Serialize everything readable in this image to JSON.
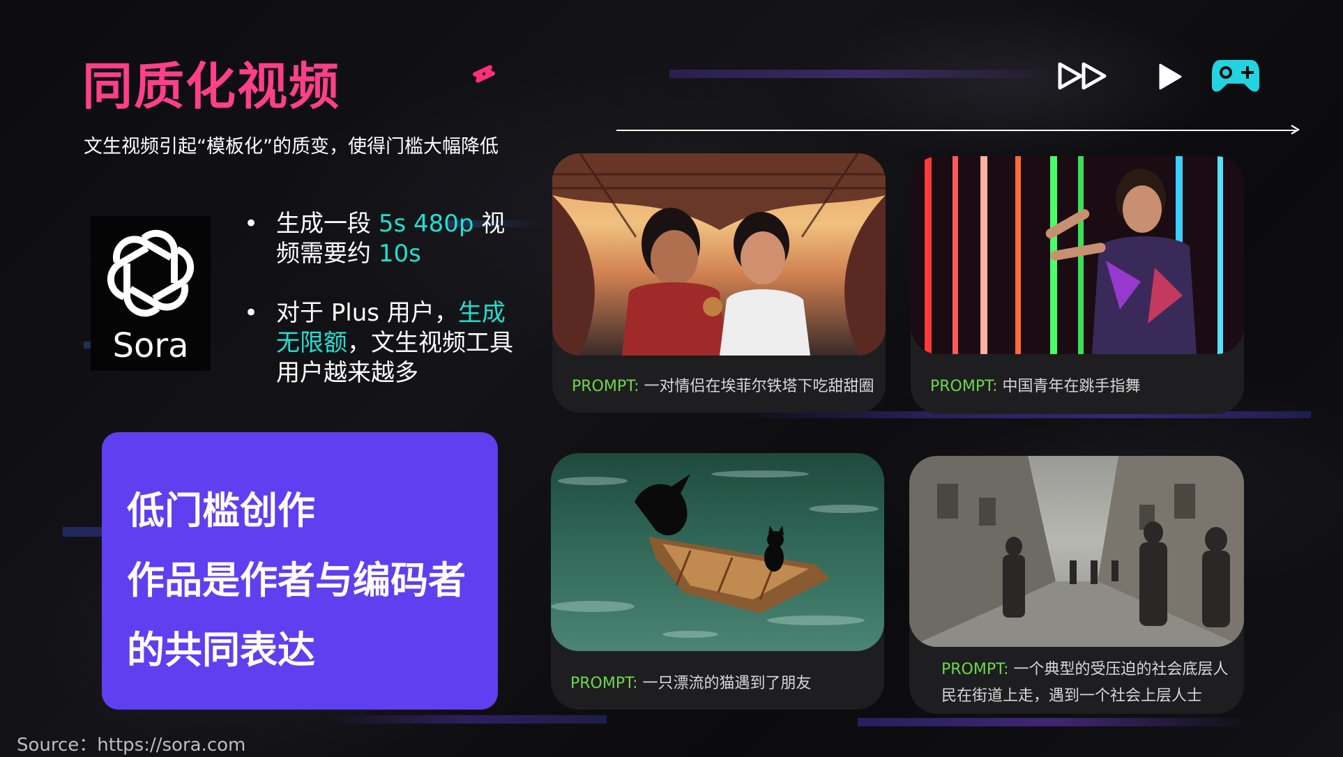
{
  "title": "同质化视频",
  "subtitle": "文生视频引起“模板化”的质变，使得门槛大幅降低",
  "sora": {
    "label": "Sora"
  },
  "bullets": [
    {
      "pre": "生成一段 ",
      "hl1": "5s 480p",
      "mid": " 视频需要约 ",
      "hl2": "10s",
      "post": ""
    },
    {
      "pre": "对于 Plus 用户，",
      "hl1": "生成无限额",
      "mid": "，文生视频工具用户越来越多",
      "hl2": "",
      "post": ""
    }
  ],
  "callout": {
    "lines": [
      "低门槛创作",
      "作品是作者与编码者",
      "的共同表达"
    ]
  },
  "cards": [
    {
      "prompt_key": "PROMPT:",
      "prompt_text": " 一对情侣在埃菲尔铁塔下吃甜甜圈"
    },
    {
      "prompt_key": "PROMPT:",
      "prompt_text": " 中国青年在跳手指舞"
    },
    {
      "prompt_key": "PROMPT:",
      "prompt_text": " 一只漂流的猫遇到了朋友"
    },
    {
      "prompt_key": "PROMPT:",
      "prompt_text": " 一个典型的受压迫的社会底层人",
      "prompt_text2": "民在街道上走，遇到一个社会上层人士"
    }
  ],
  "source": "Source：https://sora.com",
  "colors": {
    "title": "#ff3f8a",
    "highlight": "#20e0d0",
    "callout_bg": "#5f3ff0",
    "prompt_key": "#6ed84a",
    "game_icon": "#22d3e0"
  },
  "icons": [
    "ticket-icon",
    "fast-forward-icon",
    "play-icon",
    "gamepad-icon",
    "openai-logo-icon"
  ]
}
